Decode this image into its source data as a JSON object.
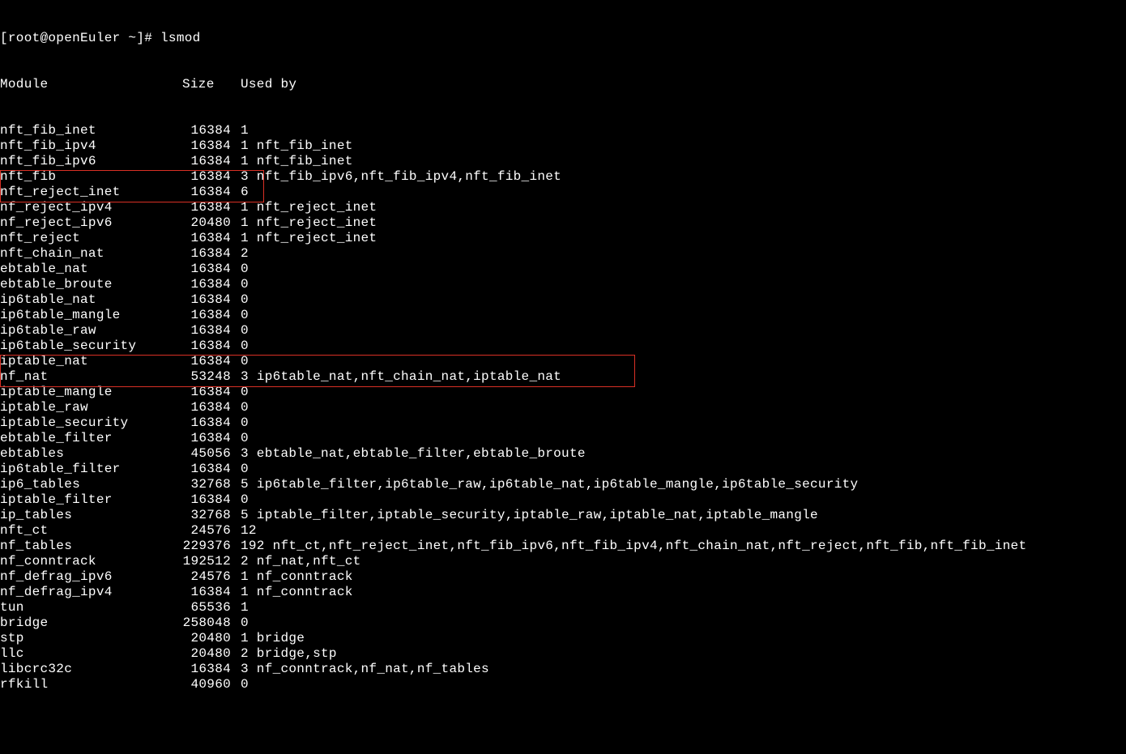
{
  "prompt": "[root@openEuler ~]# lsmod",
  "header": {
    "module": "Module",
    "size": "Size",
    "used_by": "Used by"
  },
  "rows": [
    {
      "module": "nft_fib_inet",
      "size": "16384",
      "used": "1",
      "by": ""
    },
    {
      "module": "nft_fib_ipv4",
      "size": "16384",
      "used": "1",
      "by": "nft_fib_inet"
    },
    {
      "module": "nft_fib_ipv6",
      "size": "16384",
      "used": "1",
      "by": "nft_fib_inet"
    },
    {
      "module": "nft_fib",
      "size": "16384",
      "used": "3",
      "by": "nft_fib_ipv6,nft_fib_ipv4,nft_fib_inet"
    },
    {
      "module": "nft_reject_inet",
      "size": "16384",
      "used": "6",
      "by": ""
    },
    {
      "module": "nf_reject_ipv4",
      "size": "16384",
      "used": "1",
      "by": "nft_reject_inet"
    },
    {
      "module": "nf_reject_ipv6",
      "size": "20480",
      "used": "1",
      "by": "nft_reject_inet"
    },
    {
      "module": "nft_reject",
      "size": "16384",
      "used": "1",
      "by": "nft_reject_inet"
    },
    {
      "module": "nft_chain_nat",
      "size": "16384",
      "used": "2",
      "by": ""
    },
    {
      "module": "ebtable_nat",
      "size": "16384",
      "used": "0",
      "by": ""
    },
    {
      "module": "ebtable_broute",
      "size": "16384",
      "used": "0",
      "by": ""
    },
    {
      "module": "ip6table_nat",
      "size": "16384",
      "used": "0",
      "by": ""
    },
    {
      "module": "ip6table_mangle",
      "size": "16384",
      "used": "0",
      "by": ""
    },
    {
      "module": "ip6table_raw",
      "size": "16384",
      "used": "0",
      "by": ""
    },
    {
      "module": "ip6table_security",
      "size": "16384",
      "used": "0",
      "by": ""
    },
    {
      "module": "iptable_nat",
      "size": "16384",
      "used": "0",
      "by": ""
    },
    {
      "module": "nf_nat",
      "size": "53248",
      "used": "3",
      "by": "ip6table_nat,nft_chain_nat,iptable_nat"
    },
    {
      "module": "iptable_mangle",
      "size": "16384",
      "used": "0",
      "by": ""
    },
    {
      "module": "iptable_raw",
      "size": "16384",
      "used": "0",
      "by": ""
    },
    {
      "module": "iptable_security",
      "size": "16384",
      "used": "0",
      "by": ""
    },
    {
      "module": "ebtable_filter",
      "size": "16384",
      "used": "0",
      "by": ""
    },
    {
      "module": "ebtables",
      "size": "45056",
      "used": "3",
      "by": "ebtable_nat,ebtable_filter,ebtable_broute"
    },
    {
      "module": "ip6table_filter",
      "size": "16384",
      "used": "0",
      "by": ""
    },
    {
      "module": "ip6_tables",
      "size": "32768",
      "used": "5",
      "by": "ip6table_filter,ip6table_raw,ip6table_nat,ip6table_mangle,ip6table_security"
    },
    {
      "module": "iptable_filter",
      "size": "16384",
      "used": "0",
      "by": ""
    },
    {
      "module": "ip_tables",
      "size": "32768",
      "used": "5",
      "by": "iptable_filter,iptable_security,iptable_raw,iptable_nat,iptable_mangle"
    },
    {
      "module": "nft_ct",
      "size": "24576",
      "used": "12",
      "by": ""
    },
    {
      "module": "nf_tables",
      "size": "229376",
      "used": "192",
      "by": "nft_ct,nft_reject_inet,nft_fib_ipv6,nft_fib_ipv4,nft_chain_nat,nft_reject,nft_fib,nft_fib_inet"
    },
    {
      "module": "nf_conntrack",
      "size": "192512",
      "used": "2",
      "by": "nf_nat,nft_ct"
    },
    {
      "module": "nf_defrag_ipv6",
      "size": "24576",
      "used": "1",
      "by": "nf_conntrack"
    },
    {
      "module": "nf_defrag_ipv4",
      "size": "16384",
      "used": "1",
      "by": "nf_conntrack"
    },
    {
      "module": "tun",
      "size": "65536",
      "used": "1",
      "by": ""
    },
    {
      "module": "bridge",
      "size": "258048",
      "used": "0",
      "by": ""
    },
    {
      "module": "stp",
      "size": "20480",
      "used": "1",
      "by": "bridge"
    },
    {
      "module": "llc",
      "size": "20480",
      "used": "2",
      "by": "bridge,stp"
    },
    {
      "module": "libcrc32c",
      "size": "16384",
      "used": "3",
      "by": "nf_conntrack,nf_nat,nf_tables"
    },
    {
      "module": "rfkill",
      "size": "40960",
      "used": "0",
      "by": ""
    }
  ]
}
